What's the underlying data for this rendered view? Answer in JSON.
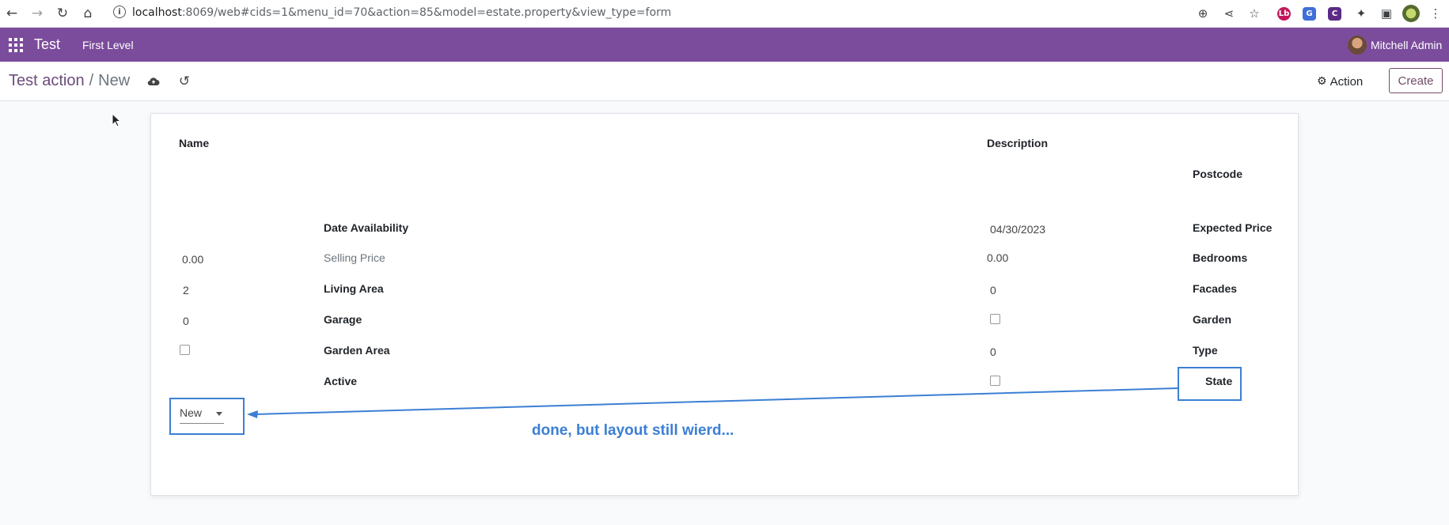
{
  "browser": {
    "url_host": "localhost",
    "url_rest": ":8069/web#cids=1&menu_id=70&action=85&model=estate.property&view_type=form"
  },
  "navbar": {
    "app_name": "Test",
    "menu_item": "First Level",
    "user_name": "Mitchell Admin"
  },
  "control_panel": {
    "breadcrumb_parent": "Test action",
    "breadcrumb_separator": "/",
    "breadcrumb_current": "New",
    "action_label": "Action",
    "create_label": "Create"
  },
  "form": {
    "name_label": "Name",
    "description_label": "Description",
    "postcode_label": "Postcode",
    "date_availability_label": "Date Availability",
    "date_availability_value": "04/30/2023",
    "expected_price_label": "Expected Price",
    "expected_price_value": "0.00",
    "selling_price_label": "Selling Price",
    "selling_price_value": "0.00",
    "bedrooms_label": "Bedrooms",
    "bedrooms_value": "2",
    "living_area_label": "Living Area",
    "living_area_value": "0",
    "facades_label": "Facades",
    "facades_value": "0",
    "garage_label": "Garage",
    "garden_label": "Garden",
    "garden_area_label": "Garden Area",
    "garden_area_value": "0",
    "type_label": "Type",
    "active_label": "Active",
    "state_label": "State",
    "state_value": "New"
  },
  "annotation": {
    "text": "done, but layout still wierd...",
    "color": "#3b7fd4"
  },
  "colors": {
    "navbar": "#7c4c9c",
    "brand_button": "#714b67"
  }
}
